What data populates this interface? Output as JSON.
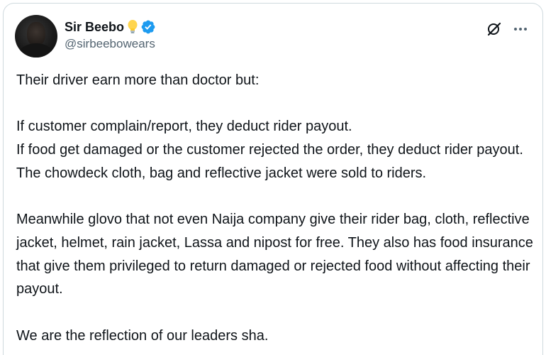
{
  "post": {
    "author": {
      "display_name": "Sir Beebo",
      "handle": "@sirbeebowears",
      "verified": true,
      "avatar_icon": "profile-photo",
      "name_emoji_icon": "light-bulb-icon"
    },
    "header_actions": {
      "grok_icon": "grok-icon",
      "more_icon": "more-options-icon"
    },
    "text": "Their driver earn more than doctor but:\n\nIf customer complain/report, they deduct rider payout.\nIf food get damaged or the customer rejected the order, they deduct rider payout.\nThe chowdeck cloth, bag and reflective jacket were sold to riders.\n\nMeanwhile glovo that not even Naija company give their rider bag, cloth, reflective jacket, helmet, rain jacket, Lassa and nipost for free. They also has food insurance that give them privileged to return damaged or rejected food without affecting their payout.\n\nWe are the reflection of our leaders sha."
  },
  "colors": {
    "text": "#0f1419",
    "secondary_text": "#536471",
    "verified_badge": "#1d9bf0",
    "border": "#cfd9de"
  }
}
